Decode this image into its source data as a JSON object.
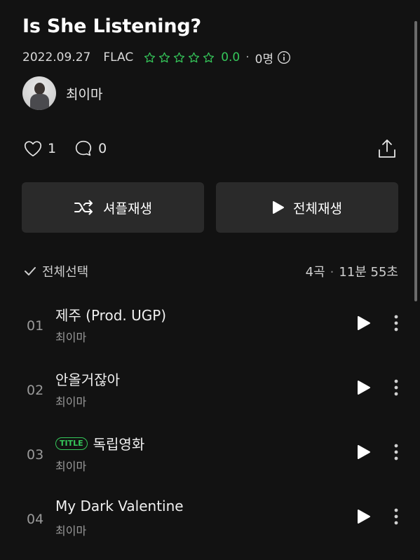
{
  "album": {
    "title": "Is She Listening?",
    "date": "2022.09.27",
    "format": "FLAC",
    "rating": "0.0",
    "raters": "0명",
    "stars": 5,
    "star_color": "#35c75a"
  },
  "artist": {
    "name": "최이마"
  },
  "social": {
    "likes": "1",
    "comments": "0"
  },
  "buttons": {
    "shuffle_label": "셔플재생",
    "play_all_label": "전체재생"
  },
  "list_header": {
    "select_all": "전체선택",
    "track_count": "4곡",
    "duration": "11분 55초"
  },
  "tracks": [
    {
      "num": "01",
      "title": "제주 (Prod. UGP)",
      "artist": "최이마",
      "badge": ""
    },
    {
      "num": "02",
      "title": "안올거잖아",
      "artist": "최이마",
      "badge": ""
    },
    {
      "num": "03",
      "title": "독립영화",
      "artist": "최이마",
      "badge": "TITLE"
    },
    {
      "num": "04",
      "title": "My Dark Valentine",
      "artist": "최이마",
      "badge": ""
    }
  ]
}
